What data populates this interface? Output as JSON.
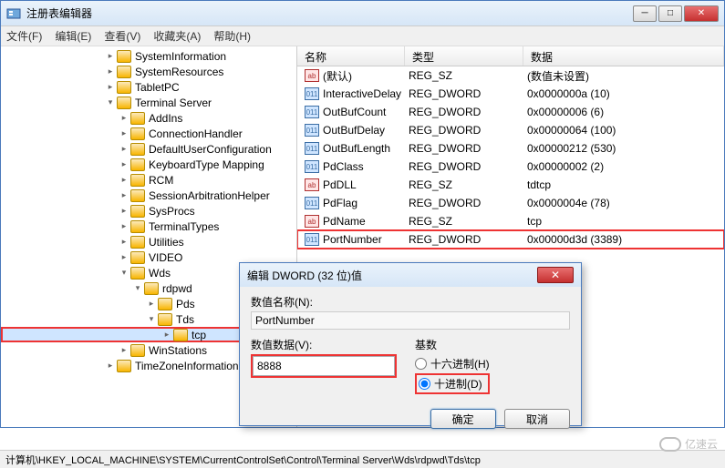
{
  "window": {
    "title": "注册表编辑器",
    "menus": [
      "文件(F)",
      "编辑(E)",
      "查看(V)",
      "收藏夹(A)",
      "帮助(H)"
    ]
  },
  "tree": {
    "items": [
      {
        "indent": 115,
        "exp": "",
        "label": "SystemInformation"
      },
      {
        "indent": 115,
        "exp": "",
        "label": "SystemResources"
      },
      {
        "indent": 115,
        "exp": "",
        "label": "TabletPC"
      },
      {
        "indent": 115,
        "exp": "▾",
        "label": "Terminal Server"
      },
      {
        "indent": 130,
        "exp": "",
        "label": "AddIns"
      },
      {
        "indent": 130,
        "exp": "",
        "label": "ConnectionHandler"
      },
      {
        "indent": 130,
        "exp": "",
        "label": "DefaultUserConfiguration"
      },
      {
        "indent": 130,
        "exp": "",
        "label": "KeyboardType Mapping"
      },
      {
        "indent": 130,
        "exp": "",
        "label": "RCM"
      },
      {
        "indent": 130,
        "exp": "",
        "label": "SessionArbitrationHelper"
      },
      {
        "indent": 130,
        "exp": "",
        "label": "SysProcs"
      },
      {
        "indent": 130,
        "exp": "",
        "label": "TerminalTypes"
      },
      {
        "indent": 130,
        "exp": "",
        "label": "Utilities"
      },
      {
        "indent": 130,
        "exp": "",
        "label": "VIDEO"
      },
      {
        "indent": 130,
        "exp": "▾",
        "label": "Wds"
      },
      {
        "indent": 145,
        "exp": "▾",
        "label": "rdpwd"
      },
      {
        "indent": 160,
        "exp": "",
        "label": "Pds"
      },
      {
        "indent": 160,
        "exp": "▾",
        "label": "Tds"
      },
      {
        "indent": 175,
        "exp": "",
        "label": "tcp",
        "selected": true,
        "hl": true
      },
      {
        "indent": 130,
        "exp": "",
        "label": "WinStations"
      },
      {
        "indent": 115,
        "exp": "",
        "label": "TimeZoneInformation"
      }
    ]
  },
  "list": {
    "headers": {
      "name": "名称",
      "type": "类型",
      "data": "数据"
    },
    "rows": [
      {
        "ico": "sz",
        "name": "(默认)",
        "type": "REG_SZ",
        "data": "(数值未设置)"
      },
      {
        "ico": "dw",
        "name": "InteractiveDelay",
        "type": "REG_DWORD",
        "data": "0x0000000a (10)"
      },
      {
        "ico": "dw",
        "name": "OutBufCount",
        "type": "REG_DWORD",
        "data": "0x00000006 (6)"
      },
      {
        "ico": "dw",
        "name": "OutBufDelay",
        "type": "REG_DWORD",
        "data": "0x00000064 (100)"
      },
      {
        "ico": "dw",
        "name": "OutBufLength",
        "type": "REG_DWORD",
        "data": "0x00000212 (530)"
      },
      {
        "ico": "dw",
        "name": "PdClass",
        "type": "REG_DWORD",
        "data": "0x00000002 (2)"
      },
      {
        "ico": "sz",
        "name": "PdDLL",
        "type": "REG_SZ",
        "data": "tdtcp"
      },
      {
        "ico": "dw",
        "name": "PdFlag",
        "type": "REG_DWORD",
        "data": "0x0000004e (78)"
      },
      {
        "ico": "sz",
        "name": "PdName",
        "type": "REG_SZ",
        "data": "tcp"
      },
      {
        "ico": "dw",
        "name": "PortNumber",
        "type": "REG_DWORD",
        "data": "0x00000d3d (3389)",
        "hl": true
      }
    ],
    "extra": "v"
  },
  "dialog": {
    "title": "编辑 DWORD (32 位)值",
    "name_label": "数值名称(N):",
    "name_value": "PortNumber",
    "data_label": "数值数据(V):",
    "data_value": "8888",
    "base_label": "基数",
    "radio_hex": "十六进制(H)",
    "radio_dec": "十进制(D)",
    "ok": "确定",
    "cancel": "取消"
  },
  "statusbar": "计算机\\HKEY_LOCAL_MACHINE\\SYSTEM\\CurrentControlSet\\Control\\Terminal Server\\Wds\\rdpwd\\Tds\\tcp",
  "watermark": "亿速云"
}
